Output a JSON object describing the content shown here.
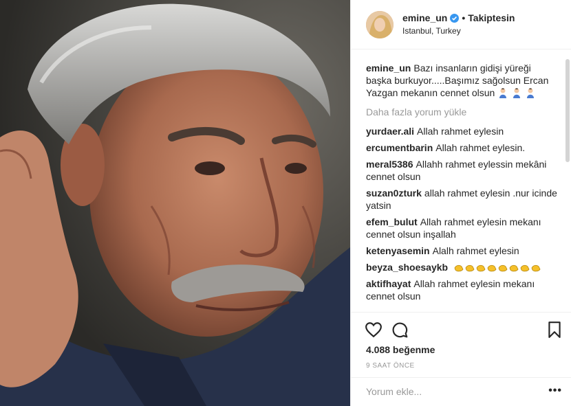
{
  "post": {
    "author": {
      "username": "emine_un",
      "verified": true,
      "follow_status": "Takiptesin",
      "location": "Istanbul, Turkey"
    },
    "caption": {
      "username": "emine_un",
      "text": "Bazı insanların gidişi yüreği başka burkuyor.....Başımız sağolsun Ercan Yazgan mekanın cennet olsun"
    },
    "load_more_comments": "Daha fazla yorum yükle",
    "comments": [
      {
        "username": "yurdaer.ali",
        "text": "Allah rahmet eylesin"
      },
      {
        "username": "ercumentbarin",
        "text": "Allah rahmet eylesin."
      },
      {
        "username": "meral5386",
        "text": "Allahh rahmet eylessin mekâni cennet olsun"
      },
      {
        "username": "suzan0zturk",
        "text": "allah rahmet eylesin .nur icinde yatsin"
      },
      {
        "username": "efem_bulut",
        "text": "Allah rahmet eylesin mekanı cennet olsun inşallah"
      },
      {
        "username": "ketenyasemin",
        "text": "Alalh rahmet eylesin"
      },
      {
        "username": "beyza_shoesaykb",
        "text": ""
      },
      {
        "username": "aktifhayat",
        "text": "Allah rahmet eylesin mekanı cennet olsun"
      }
    ],
    "likes": "4.088 beğenme",
    "time": "9 SAAT ÖNCE",
    "add_comment_placeholder": "Yorum ekle...",
    "more_options": "•••",
    "icons": {
      "like": "heart-icon",
      "comment": "comment-icon",
      "save": "bookmark-icon",
      "verified": "verified-badge-icon",
      "praying_emoji": "praying-woman-emoji",
      "clap_emoji": "clapping-hands-emoji"
    },
    "colors": {
      "verified_blue": "#3897f0",
      "muted_text": "#999999",
      "border": "#efefef"
    }
  }
}
